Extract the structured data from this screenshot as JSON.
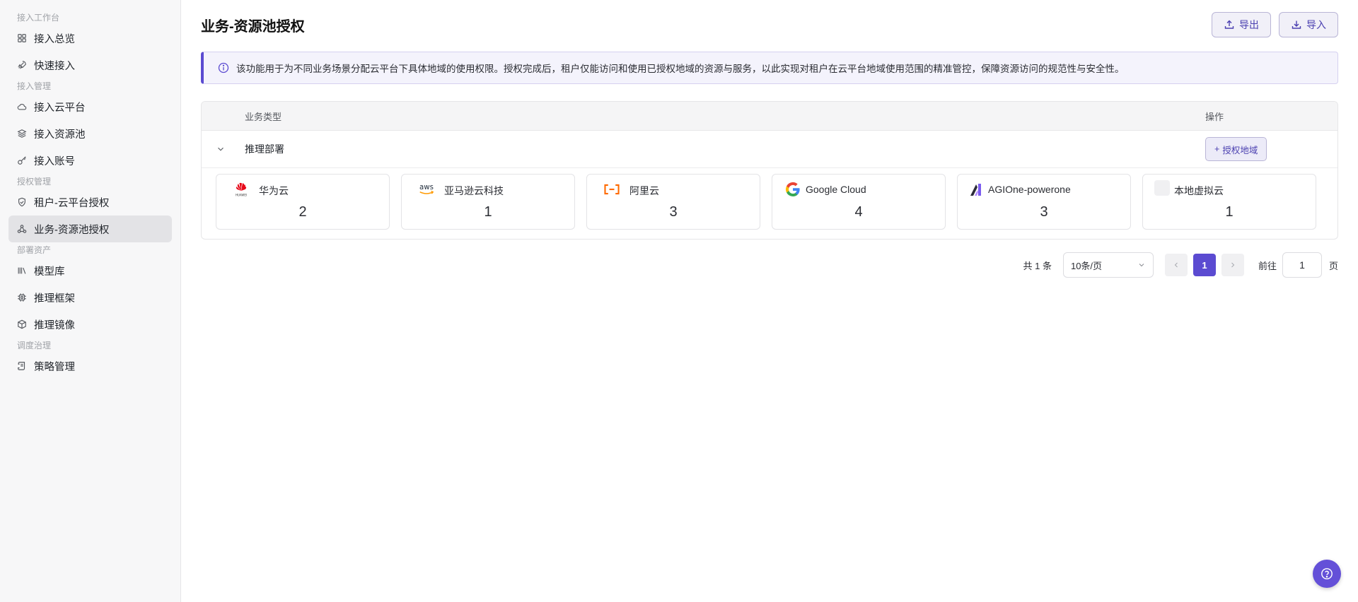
{
  "sidebar": {
    "groups": [
      {
        "title": "接入工作台",
        "items": [
          {
            "label": "接入总览",
            "icon": "grid-icon"
          },
          {
            "label": "快速接入",
            "icon": "rocket-icon"
          }
        ]
      },
      {
        "title": "接入管理",
        "items": [
          {
            "label": "接入云平台",
            "icon": "cloud-icon"
          },
          {
            "label": "接入资源池",
            "icon": "layers-icon"
          },
          {
            "label": "接入账号",
            "icon": "key-icon"
          }
        ]
      },
      {
        "title": "授权管理",
        "items": [
          {
            "label": "租户-云平台授权",
            "icon": "shield-check-icon"
          },
          {
            "label": "业务-资源池授权",
            "icon": "network-icon",
            "active": true
          }
        ]
      },
      {
        "title": "部署资产",
        "items": [
          {
            "label": "模型库",
            "icon": "library-icon"
          },
          {
            "label": "推理框架",
            "icon": "chip-icon"
          },
          {
            "label": "推理镜像",
            "icon": "box-icon"
          }
        ]
      },
      {
        "title": "调度治理",
        "items": [
          {
            "label": "策略管理",
            "icon": "scroll-icon"
          }
        ]
      }
    ]
  },
  "header": {
    "title": "业务-资源池授权",
    "export_label": "导出",
    "import_label": "导入"
  },
  "notice": {
    "text": "该功能用于为不同业务场景分配云平台下具体地域的使用权限。授权完成后，租户仅能访问和使用已授权地域的资源与服务，以此实现对租户在云平台地域使用范围的精准管控，保障资源访问的规范性与安全性。"
  },
  "table": {
    "col_type": "业务类型",
    "col_op": "操作",
    "row": {
      "name": "推理部署",
      "auth_label": "授权地域",
      "platforms": [
        {
          "name": "华为云",
          "count": "2",
          "logo": "huawei-logo"
        },
        {
          "name": "亚马逊云科技",
          "count": "1",
          "logo": "aws-logo"
        },
        {
          "name": "阿里云",
          "count": "3",
          "logo": "aliyun-logo"
        },
        {
          "name": "Google Cloud",
          "count": "4",
          "logo": "google-logo"
        },
        {
          "name": "AGIOne-powerone",
          "count": "3",
          "logo": "agione-logo"
        },
        {
          "name": "本地虚拟云",
          "count": "1",
          "logo": "local-cloud-logo"
        }
      ]
    }
  },
  "pagination": {
    "total_text": "共 1 条",
    "page_size": "10条/页",
    "current_page": "1",
    "goto_label": "前往",
    "goto_value": "1",
    "page_unit": "页"
  },
  "colors": {
    "accent": "#5b4bd1",
    "huawei": "#e60012",
    "aliyun": "#ff6a00"
  }
}
